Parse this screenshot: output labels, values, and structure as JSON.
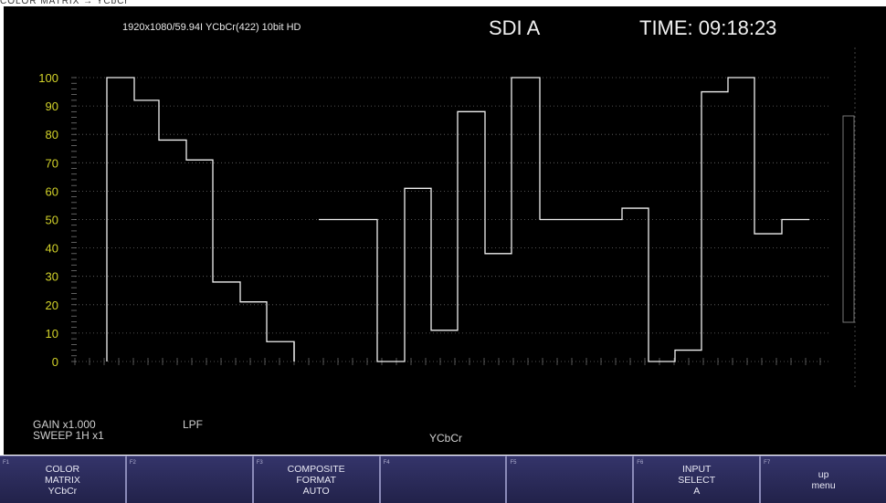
{
  "top_caption": "COLOR MATRIX → YCbCr",
  "header": {
    "format": "1920x1080/59.94I YCbCr(422) 10bit HD",
    "input": "SDI A",
    "time": "TIME: 09:18:23"
  },
  "scale": {
    "labels": [
      "100",
      "90",
      "80",
      "70",
      "60",
      "50",
      "40",
      "30",
      "20",
      "10",
      "0"
    ],
    "label_color": "#d4d42a",
    "trace_color": "#f0f0f0"
  },
  "waveform": {
    "y_levels": [
      100,
      92,
      78,
      71,
      28,
      21,
      7,
      0,
      50,
      0,
      61,
      11,
      88,
      38,
      100,
      50,
      54,
      0,
      4,
      95,
      100,
      45,
      50
    ],
    "note_unit": "percent"
  },
  "status": {
    "gain": "GAIN x1.000",
    "sweep": "SWEEP 1H x1",
    "filter": "LPF",
    "mode": "YCbCr"
  },
  "function_keys": [
    {
      "num": "F1",
      "lines": [
        "COLOR",
        "MATRIX",
        "YCbCr"
      ]
    },
    {
      "num": "F2",
      "lines": [
        "",
        "",
        ""
      ]
    },
    {
      "num": "F3",
      "lines": [
        "COMPOSITE",
        "FORMAT",
        "AUTO"
      ]
    },
    {
      "num": "F4",
      "lines": [
        "",
        "",
        ""
      ]
    },
    {
      "num": "F5",
      "lines": [
        "",
        "",
        ""
      ]
    },
    {
      "num": "F6",
      "lines": [
        "INPUT",
        "SELECT",
        "A"
      ]
    },
    {
      "num": "F7",
      "lines": [
        "up",
        "menu",
        ""
      ]
    }
  ]
}
